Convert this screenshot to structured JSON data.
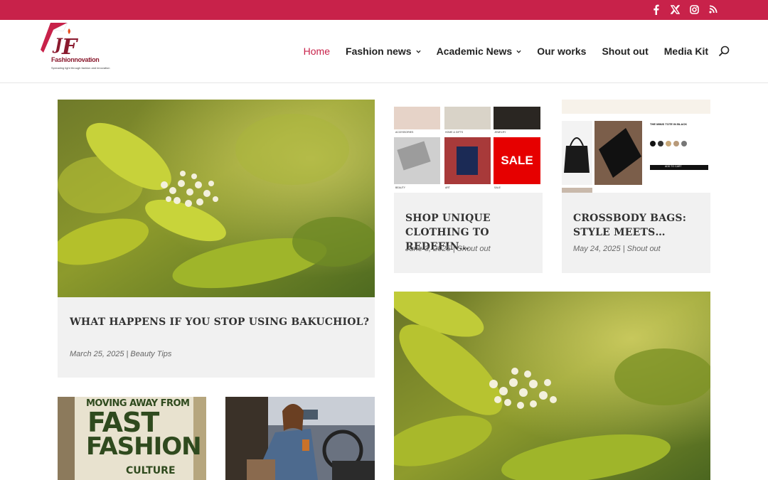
{
  "social": {
    "facebook": "facebook-icon",
    "x": "x-icon",
    "instagram": "instagram-icon",
    "rss": "rss-icon"
  },
  "brand": {
    "name": "Fashionnovation",
    "tagline": "Spreading light through fashion and innovation"
  },
  "nav": {
    "home": "Home",
    "fashion_news": "Fashion news",
    "academic_news": "Academic News",
    "our_works": "Our works",
    "shout_out": "Shout out",
    "media_kit": "Media Kit"
  },
  "colors": {
    "accent": "#c8224a",
    "card_bg": "#f1f1f1"
  },
  "posts": [
    {
      "title": "WHAT HAPPENS IF YOU STOP USING BAKUCHIOL?",
      "date": "March 25, 2025",
      "sep": "|",
      "category": "Beauty Tips"
    },
    {
      "title_line1": "SHOP UNIQUE",
      "title_line2": "CLOTHING TO REDEFIN…",
      "date": "June 3, 2025",
      "sep": "|",
      "category": "Shout out",
      "thumb_labels": {
        "sale": "SALE",
        "accessories": "ACCESSORIES",
        "home": "HOME & GIFTS",
        "jewelry": "JEWELRY",
        "beauty": "BEAUTY",
        "art": "ART",
        "sale_small": "SALE"
      }
    },
    {
      "title_line1": "CROSSBODY BAGS:",
      "title_line2": "STYLE MEETS…",
      "date": "May 24, 2025",
      "sep": "|",
      "category": "Shout out",
      "thumb_labels": {
        "product": "THE MINIS TOTE IN BLACK",
        "add_to_cart": "ADD TO CART"
      }
    },
    {
      "poster_line1": "MOVING AWAY FROM",
      "poster_line2": "FAST",
      "poster_line3": "FASHION",
      "poster_line4": "CULTURE"
    }
  ]
}
